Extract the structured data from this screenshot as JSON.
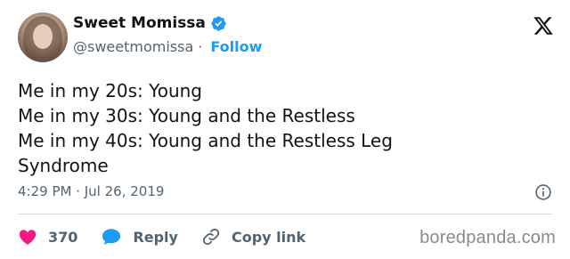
{
  "author": {
    "name": "Sweet Momissa",
    "handle": "@sweetmomissa",
    "separator": "·",
    "follow_label": "Follow"
  },
  "tweet": {
    "text": "Me in my 20s: Young\nMe in my 30s: Young and the Restless\nMe in my 40s: Young and the Restless Leg\nSyndrome",
    "timestamp": "4:29 PM · Jul 26, 2019"
  },
  "actions": {
    "likes_count": "370",
    "reply_label": "Reply",
    "copy_link_label": "Copy link"
  },
  "watermark": "boredpanda.com",
  "icons": {
    "verified": "verified-badge-icon",
    "x_logo": "x-logo-icon",
    "info": "info-icon",
    "heart": "heart-icon",
    "reply": "reply-bubble-icon",
    "link": "link-icon"
  },
  "colors": {
    "accent": "#1d9bf0",
    "heart": "#f91880",
    "secondary_text": "#536471"
  }
}
